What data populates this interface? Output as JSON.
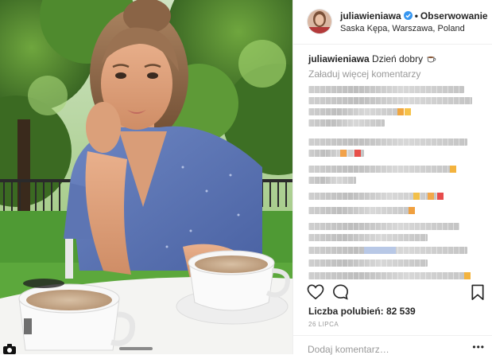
{
  "post": {
    "username": "juliawieniawa",
    "verified": true,
    "separator": "•",
    "follow_status": "Obserwowanie",
    "location": "Saska Kępa, Warszawa, Poland",
    "caption_user": "juliawieniawa",
    "caption_text": "Dzień dobry",
    "caption_emoji": "coffee-icon",
    "load_more_comments": "Załaduj więcej komentarzy",
    "likes_text": "Liczba polubień: 82 539",
    "date": "26 LIPCA",
    "add_comment_placeholder": "Dodaj komentarz…",
    "options_label": "•••"
  },
  "icons": {
    "like": "heart-icon",
    "comment": "comment-bubble-icon",
    "save": "bookmark-icon",
    "verified": "verified-badge-icon"
  },
  "colors": {
    "verified_blue": "#3897f0",
    "text": "#262626",
    "muted": "#999999",
    "border": "#efefef"
  }
}
